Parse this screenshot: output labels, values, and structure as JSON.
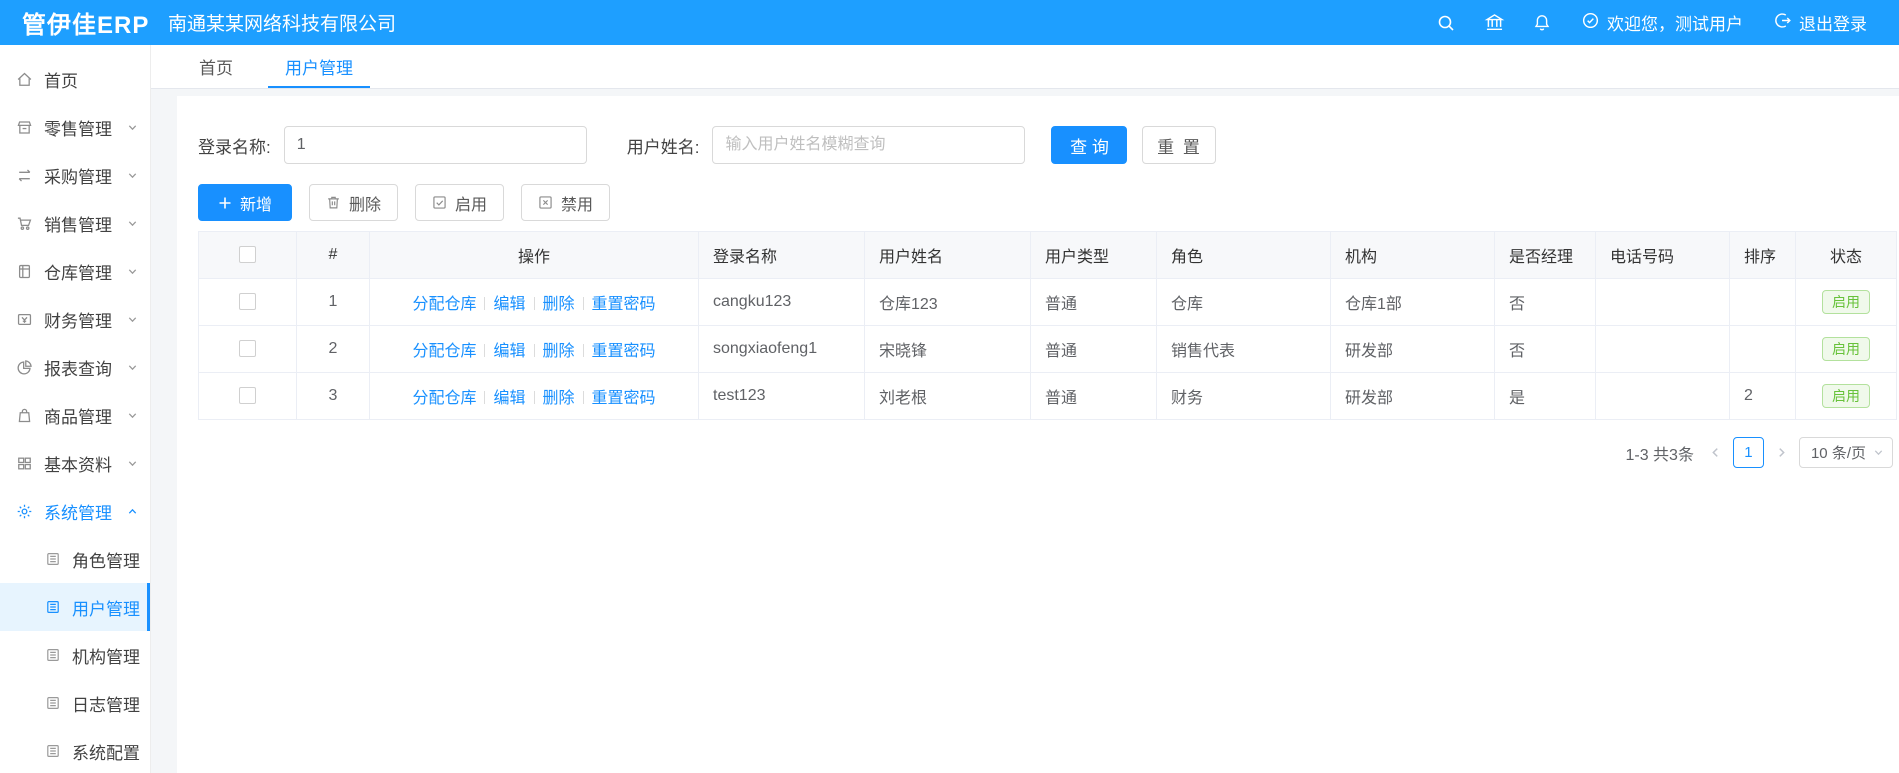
{
  "colors": {
    "accent": "#1890ff",
    "header_bg": "#1e9fff",
    "success": "#67c23a",
    "active_menu_bg": "#e7f4fe"
  },
  "header": {
    "logo": "管伊佳ERP",
    "company": "南通某某网络科技有限公司",
    "icons": [
      "search-icon",
      "bank-icon",
      "bell-icon",
      "user-check-icon",
      "logout-icon"
    ],
    "welcome": "欢迎您，测试用户",
    "logout": "退出登录"
  },
  "sidebar": {
    "items": [
      {
        "label": "首页",
        "icon": "home-icon"
      },
      {
        "label": "零售管理",
        "icon": "shop-icon",
        "chevron": "down"
      },
      {
        "label": "采购管理",
        "icon": "purchase-icon",
        "chevron": "down"
      },
      {
        "label": "销售管理",
        "icon": "cart-icon",
        "chevron": "down"
      },
      {
        "label": "仓库管理",
        "icon": "warehouse-icon",
        "chevron": "down"
      },
      {
        "label": "财务管理",
        "icon": "finance-icon",
        "chevron": "down"
      },
      {
        "label": "报表查询",
        "icon": "report-icon",
        "chevron": "down"
      },
      {
        "label": "商品管理",
        "icon": "goods-icon",
        "chevron": "down"
      },
      {
        "label": "基本资料",
        "icon": "basic-icon",
        "chevron": "down"
      },
      {
        "label": "系统管理",
        "icon": "gear-icon",
        "chevron": "up",
        "active": true
      }
    ],
    "subitems": [
      {
        "label": "角色管理",
        "icon": "doc-icon"
      },
      {
        "label": "用户管理",
        "icon": "doc-icon",
        "active": true
      },
      {
        "label": "机构管理",
        "icon": "doc-icon"
      },
      {
        "label": "日志管理",
        "icon": "doc-icon"
      },
      {
        "label": "系统配置",
        "icon": "doc-icon"
      }
    ]
  },
  "tabs": [
    {
      "label": "首页"
    },
    {
      "label": "用户管理",
      "active": true
    }
  ],
  "search": {
    "login_label": "登录名称:",
    "login_value": "1",
    "name_label": "用户姓名:",
    "name_placeholder": "输入用户姓名模糊查询",
    "query_label": "查 询",
    "reset_label": "重 置"
  },
  "toolbar": {
    "add_label": "新增",
    "delete_label": "删除",
    "enable_label": "启用",
    "disable_label": "禁用"
  },
  "table": {
    "headers": [
      "#",
      "操作",
      "登录名称",
      "用户姓名",
      "用户类型",
      "角色",
      "机构",
      "是否经理",
      "电话号码",
      "排序",
      "状态"
    ],
    "ops": [
      "分配仓库",
      "编辑",
      "删除",
      "重置密码"
    ],
    "rows": [
      {
        "index": "1",
        "login": "cangku123",
        "name": "仓库123",
        "type": "普通",
        "role": "仓库",
        "org": "仓库1部",
        "manager": "否",
        "phone": "",
        "sort": "",
        "status": "启用"
      },
      {
        "index": "2",
        "login": "songxiaofeng1",
        "name": "宋晓锋",
        "type": "普通",
        "role": "销售代表",
        "org": "研发部",
        "manager": "否",
        "phone": "",
        "sort": "",
        "status": "启用"
      },
      {
        "index": "3",
        "login": "test123",
        "name": "刘老根",
        "type": "普通",
        "role": "财务",
        "org": "研发部",
        "manager": "是",
        "phone": "",
        "sort": "2",
        "status": "启用"
      }
    ]
  },
  "pagination": {
    "total_text": "1-3 共3条",
    "current_page": "1",
    "page_size": "10 条/页"
  }
}
